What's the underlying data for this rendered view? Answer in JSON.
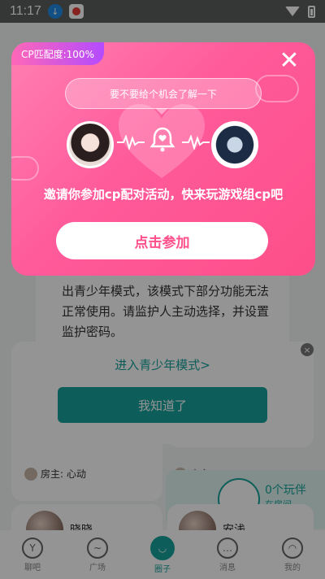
{
  "status_bar": {
    "time": "11:17"
  },
  "background": {
    "youth_dialog": {
      "text": "出青少年模式，该模式下部分功能无法正常使用。请监护人主动选择，并设置监护密码。",
      "link": "进入青少年模式>",
      "button": "我知道了"
    },
    "rooms": [
      {
        "host_label": "房主:",
        "host_name": "心动"
      },
      {
        "host_label": "房主:"
      }
    ],
    "players": {
      "count": "0个玩伴",
      "sub": "在房间"
    },
    "users": [
      "晓晓",
      "安浅"
    ]
  },
  "tabs": [
    {
      "label": "聊吧",
      "icon": "chat-icon"
    },
    {
      "label": "广场",
      "icon": "square-icon"
    },
    {
      "label": "圈子",
      "icon": "circle-icon"
    },
    {
      "label": "消息",
      "icon": "message-icon"
    },
    {
      "label": "我的",
      "icon": "profile-icon"
    }
  ],
  "popup": {
    "match_badge": "CP匹配度:100%",
    "bubble_text": "要不要给个机会了解一下",
    "invite_text": "邀请你参加cp配对活动，快来玩游戏组cp吧",
    "join_button": "点击参加",
    "accent_color": "#ff5a9a"
  }
}
